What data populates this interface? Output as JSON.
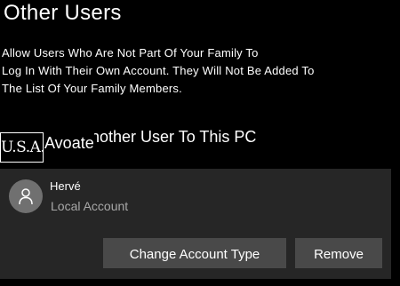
{
  "section": {
    "title": "Other Users"
  },
  "description": {
    "line1": "Allow Users Who Are Not Part Of Your Family To",
    "line2": "Log In With Their Own Account. They Will Not Be Added To",
    "line3": "The List Of Your Family Members."
  },
  "add_user": {
    "overlay_badge": "U.S.A.",
    "overlay_word": "Avoate",
    "label": "nother User To This PC"
  },
  "account": {
    "name": "Hervé",
    "type": "Local Account",
    "avatar_icon": "person-icon",
    "change_type_label": "Change Account Type",
    "remove_label": "Remove"
  },
  "colors": {
    "background": "#000000",
    "panel": "#262626",
    "button": "#494949",
    "avatar": "#707070",
    "secondary_text": "#a8a8a8"
  }
}
